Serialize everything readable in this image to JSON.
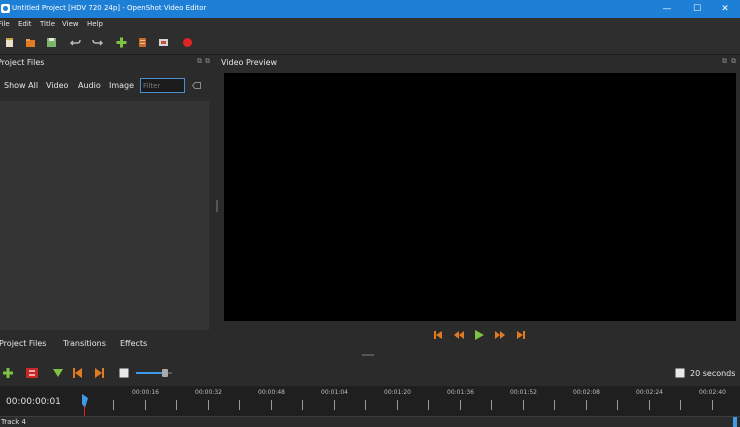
{
  "window": {
    "title": "Untitled Project [HDV 720 24p] - OpenShot Video Editor",
    "controls": {
      "minimize": "—",
      "maximize": "☐",
      "close": "✕"
    }
  },
  "menu": {
    "file": "File",
    "edit": "Edit",
    "title": "Title",
    "view": "View",
    "help": "Help"
  },
  "toolbar": {
    "icons": [
      "new-project-icon",
      "open-project-icon",
      "save-project-icon",
      "undo-icon",
      "redo-icon",
      "import-files-icon",
      "profile-icon",
      "fullscreen-icon",
      "export-video-icon"
    ]
  },
  "project_files": {
    "title": "Project Files",
    "filters": {
      "show_all": "Show All",
      "video": "Video",
      "audio": "Audio",
      "image": "Image"
    },
    "filter_placeholder": "Filter"
  },
  "video_preview": {
    "title": "Video Preview",
    "controls": [
      "jump-start-icon",
      "rewind-icon",
      "play-icon",
      "fast-forward-icon",
      "jump-end-icon"
    ]
  },
  "bottom_tabs": {
    "project_files": "Project Files",
    "transitions": "Transitions",
    "effects": "Effects"
  },
  "timeline": {
    "toolbar_icons": [
      "add-track-icon",
      "snap-icon",
      "add-marker-icon",
      "previous-marker-icon",
      "next-marker-icon",
      "center-playhead-icon"
    ],
    "zoom_level": 0.8,
    "zoom_label": "20 seconds",
    "timecode": "00:00:00:01",
    "ruler_labels": [
      "00:00:16",
      "00:00:32",
      "00:00:48",
      "00:01:04",
      "00:01:20",
      "00:01:36",
      "00:01:52",
      "00:02:08",
      "00:02:24",
      "00:02:40"
    ],
    "track_label": "Track 4"
  },
  "colors": {
    "titlebar": "#1e7fd6",
    "accent_orange": "#e07b22",
    "accent_green": "#7dc242",
    "record_red": "#e02424"
  }
}
